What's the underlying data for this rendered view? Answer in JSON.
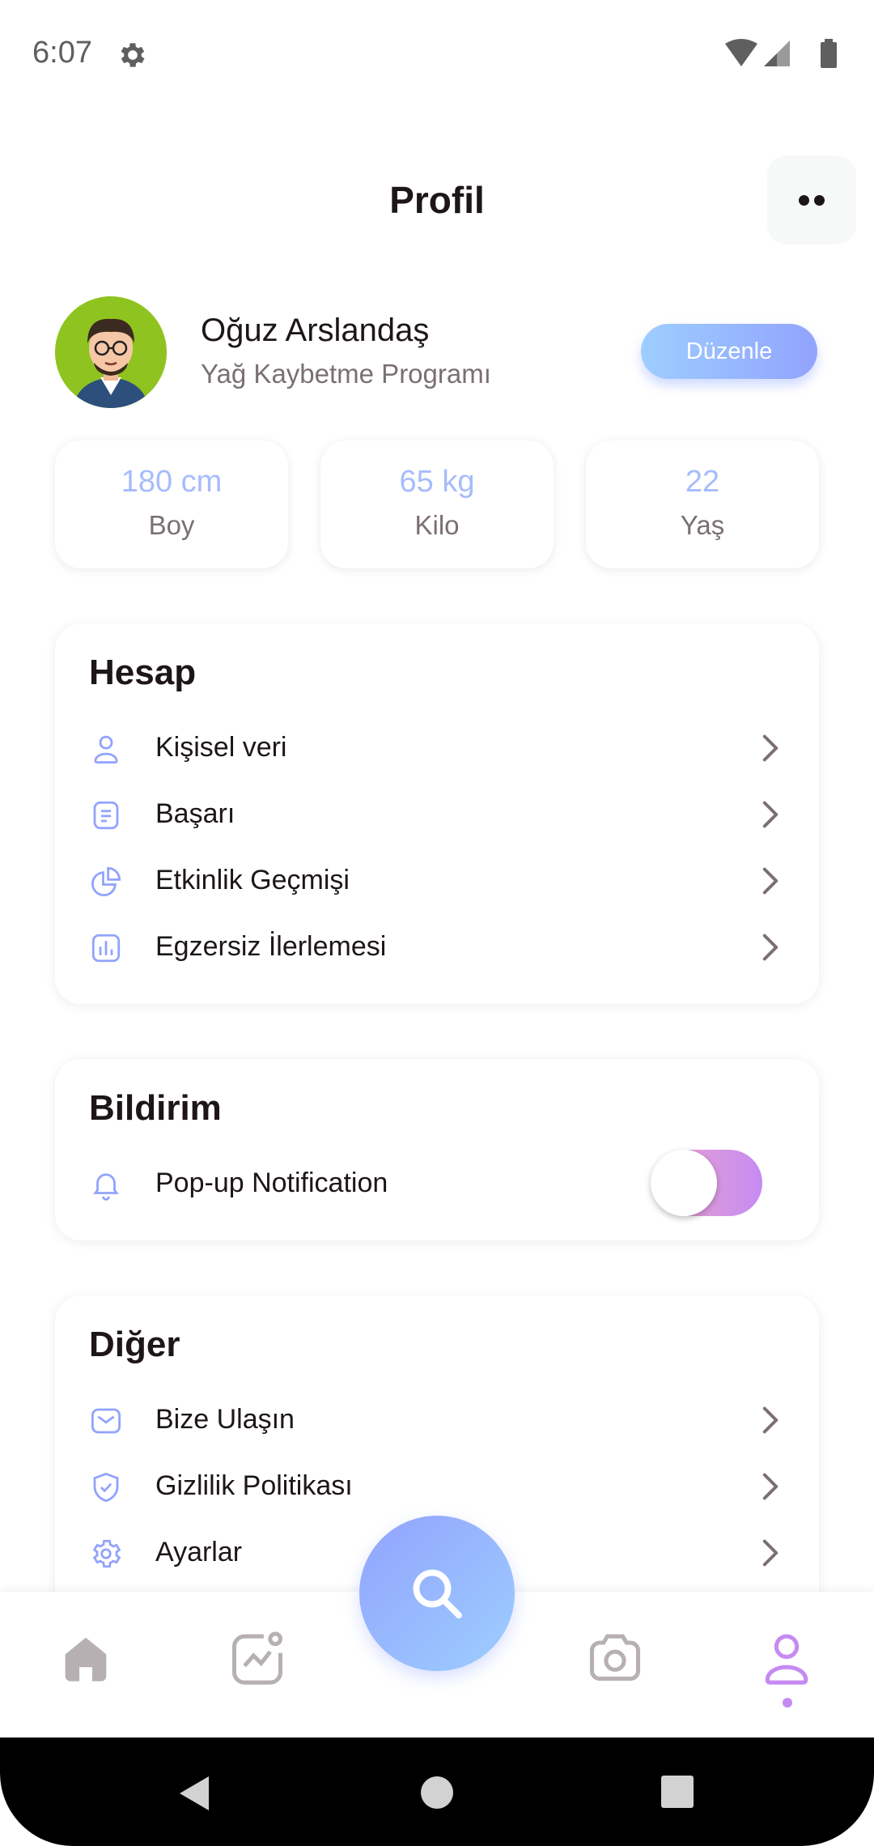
{
  "status_bar": {
    "time": "6:07"
  },
  "header": {
    "title": "Profil"
  },
  "profile": {
    "name": "Oğuz Arslandaş",
    "program": "Yağ Kaybetme Programı",
    "edit_label": "Düzenle"
  },
  "stats": [
    {
      "value": "180 cm",
      "label": "Boy"
    },
    {
      "value": "65 kg",
      "label": "Kilo"
    },
    {
      "value": "22",
      "label": "Yaş"
    }
  ],
  "account": {
    "title": "Hesap",
    "items": [
      {
        "label": "Kişisel veri",
        "icon": "user-icon"
      },
      {
        "label": "Başarı",
        "icon": "document-icon"
      },
      {
        "label": "Etkinlik Geçmişi",
        "icon": "pie-chart-icon"
      },
      {
        "label": "Egzersiz İlerlemesi",
        "icon": "bar-chart-icon"
      }
    ]
  },
  "notification": {
    "title": "Bildirim",
    "item": {
      "label": "Pop-up Notification",
      "icon": "bell-icon",
      "enabled": true
    }
  },
  "other": {
    "title": "Diğer",
    "items": [
      {
        "label": "Bize Ulaşın",
        "icon": "mail-icon"
      },
      {
        "label": "Gizlilik Politikası",
        "icon": "shield-icon"
      },
      {
        "label": "Ayarlar",
        "icon": "gear-icon"
      }
    ]
  },
  "bottom_nav": {
    "items": [
      "home-icon",
      "activity-icon",
      "search-icon",
      "camera-icon",
      "profile-icon"
    ],
    "active": "profile-icon"
  },
  "colors": {
    "primary_start": "#92a3fd",
    "primary_end": "#9dceff",
    "secondary_start": "#c58bf2",
    "secondary_end": "#eea4ce",
    "text": "#1d1617",
    "muted": "#7b6f72"
  }
}
